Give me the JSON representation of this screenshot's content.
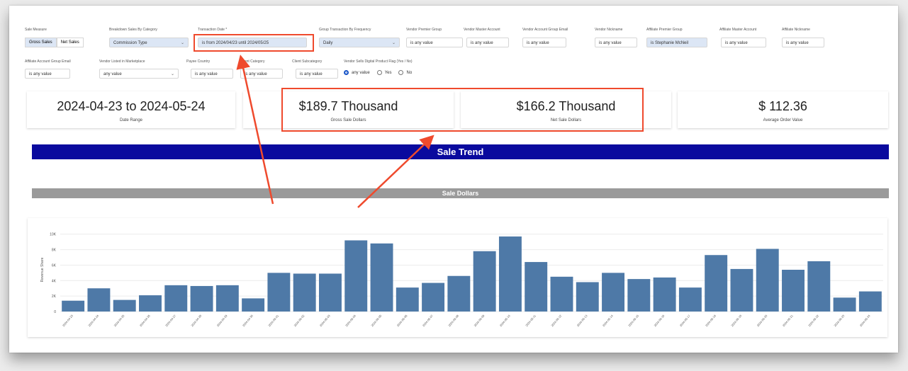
{
  "filters": {
    "row1": [
      {
        "label": "Sale Measure",
        "type": "segmented",
        "options": [
          "Gross Sales",
          "Net Sales"
        ],
        "active": 0
      },
      {
        "label": "Breakdown Sales By Category",
        "type": "dropdown",
        "value": "Commission Type"
      },
      {
        "label": "Transaction Date *",
        "type": "date",
        "value": "is from 2024/04/23 until 2024/05/25"
      },
      {
        "label": "Group Transaction By Frequency",
        "type": "dropdown",
        "value": "Daily"
      },
      {
        "label": "Vendor Premier Group",
        "type": "text",
        "value": "is any value"
      },
      {
        "label": "Vendor Master Account",
        "type": "text",
        "value": "is any value"
      },
      {
        "label": "Vendor Account Group Email",
        "type": "text",
        "value": "is any value"
      },
      {
        "label": "Vendor Nickname",
        "type": "text",
        "value": "is any value"
      },
      {
        "label": "Affiliate Premier Group",
        "type": "text",
        "value": "is Stephanie McNeil"
      },
      {
        "label": "Affiliate Master Account",
        "type": "text",
        "value": "is any value"
      },
      {
        "label": "Affiliate Nickname",
        "type": "text",
        "value": "is any value"
      }
    ],
    "row2": [
      {
        "label": "Affiliate Account Group Email",
        "type": "text",
        "value": "is any value"
      },
      {
        "label": "Vendor Listed in Marketplace",
        "type": "dropdown",
        "value": "any value"
      },
      {
        "label": "Payee Country",
        "type": "text",
        "value": "is any value"
      },
      {
        "label": "Client Category",
        "type": "text",
        "value": "is any value"
      },
      {
        "label": "Client Subcategory",
        "type": "text",
        "value": "is any value"
      },
      {
        "label": "Vendor Sells Digital Product Flag (Yes / No)",
        "type": "radio",
        "options": [
          "any value",
          "Yes",
          "No"
        ],
        "selected": 0
      }
    ]
  },
  "kpis": [
    {
      "value": "2024-04-23 to 2024-05-24",
      "label": "Date Range"
    },
    {
      "value": "$189.7 Thousand",
      "label": "Gross Sale Dollars"
    },
    {
      "value": "$166.2 Thousand",
      "label": "Net Sale Dollars"
    },
    {
      "value": "$ 112.36",
      "label": "Average Order Value"
    }
  ],
  "banners": {
    "trend": "Sale Trend",
    "dollars": "Sale Dollars"
  },
  "colors": {
    "trend_banner": "#0a0a9e",
    "dollars_banner": "#9a9a9a",
    "bar": "#4e79a7",
    "highlight": "#ef4a2d"
  },
  "chart_data": {
    "type": "bar",
    "ylabel": "Revenue Share",
    "yticks": [
      "0",
      "2K",
      "4K",
      "6K",
      "8K",
      "10K"
    ],
    "ylim": [
      0,
      10800
    ],
    "categories": [
      "2024-04-23",
      "2024-04-24",
      "2024-04-25",
      "2024-04-26",
      "2024-04-27",
      "2024-04-28",
      "2024-04-29",
      "2024-04-30",
      "2024-05-01",
      "2024-05-02",
      "2024-05-03",
      "2024-05-04",
      "2024-05-05",
      "2024-05-06",
      "2024-05-07",
      "2024-05-08",
      "2024-05-09",
      "2024-05-10",
      "2024-05-11",
      "2024-05-12",
      "2024-05-13",
      "2024-05-14",
      "2024-05-15",
      "2024-05-16",
      "2024-05-17",
      "2024-05-18",
      "2024-05-19",
      "2024-05-20",
      "2024-05-21",
      "2024-05-22",
      "2024-05-23",
      "2024-05-24"
    ],
    "values": [
      1400,
      3000,
      1500,
      2100,
      3400,
      3300,
      3400,
      1700,
      5000,
      4900,
      4900,
      9200,
      8800,
      3100,
      3700,
      4600,
      7800,
      9700,
      6400,
      4500,
      3800,
      5000,
      4200,
      4400,
      3100,
      7300,
      5500,
      8100,
      5400,
      6500,
      1800,
      2600
    ]
  }
}
